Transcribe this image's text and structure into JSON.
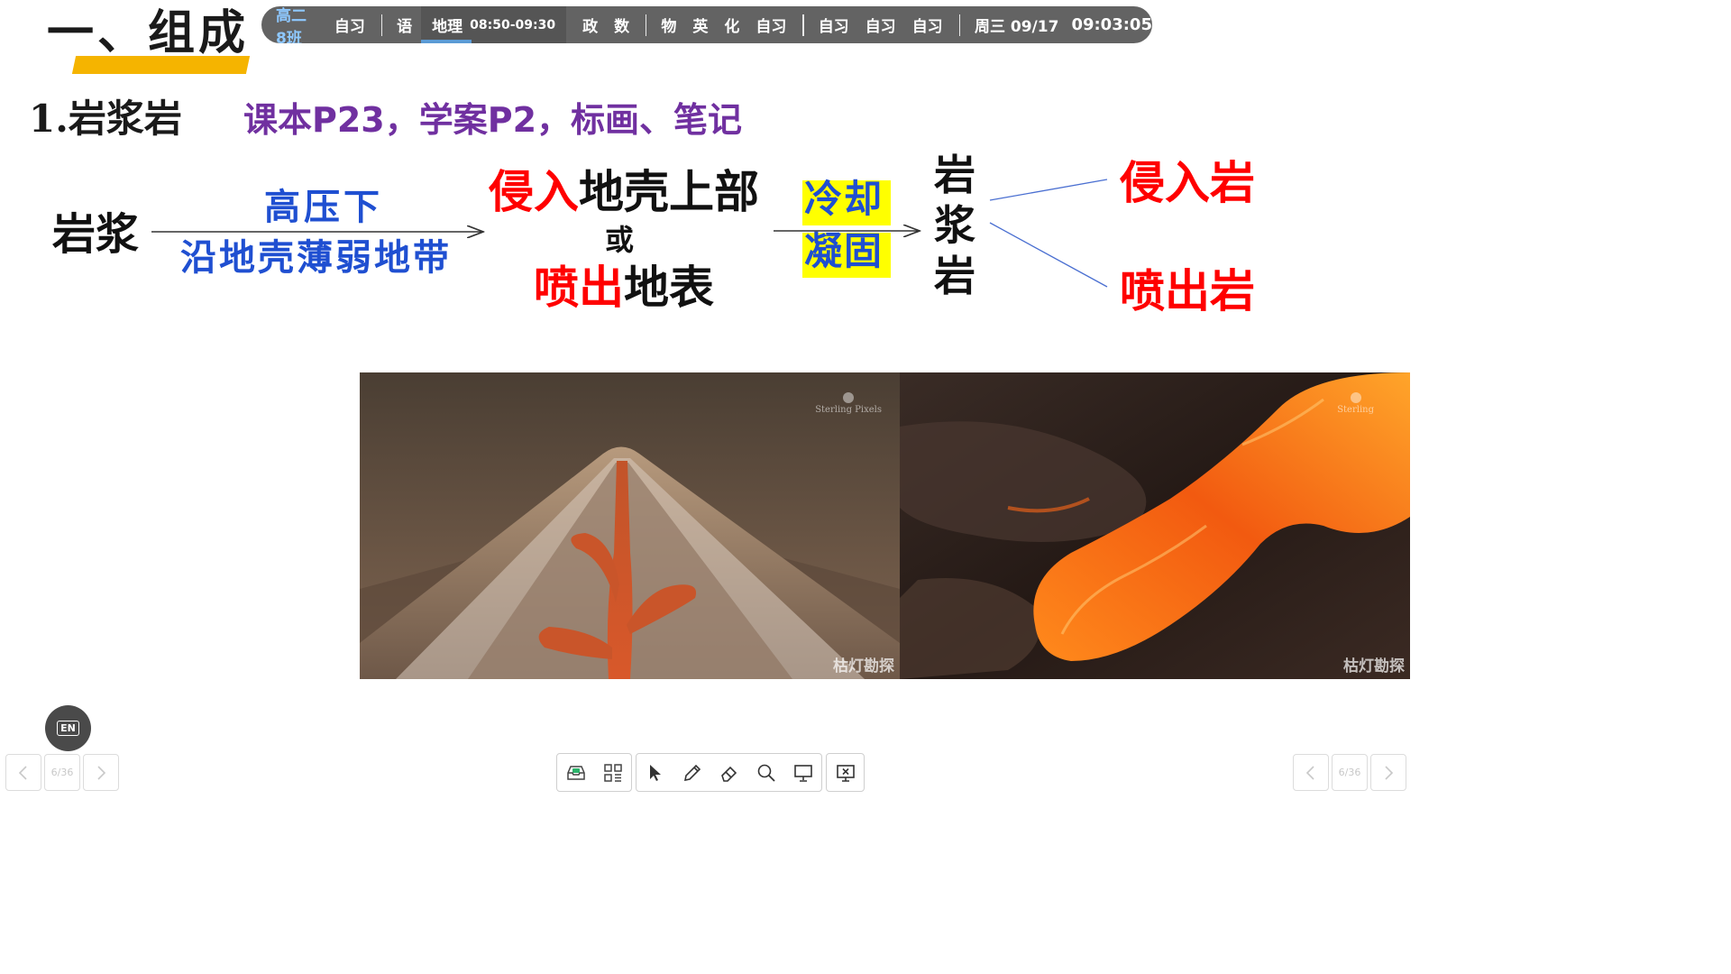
{
  "header": {
    "section_title": "一、组成"
  },
  "schedule": {
    "class_name": "高二8班",
    "slots_before": [
      "自习"
    ],
    "slot_chinese": "语",
    "current": {
      "subject": "地理",
      "time": "08:50-09:30",
      "progress": 0.35
    },
    "slots_mid": [
      "政",
      "数"
    ],
    "slots_group2": [
      "物",
      "英",
      "化",
      "自习"
    ],
    "slots_group3": [
      "自习",
      "自习",
      "自习"
    ],
    "date": "周三 09/17",
    "clock": "09:03:05"
  },
  "content": {
    "subheading": "1.岩浆岩",
    "reference": "课本P23，学案P2，标画、笔记"
  },
  "diagram": {
    "source": "岩浆",
    "condition_top": "高压下",
    "condition_bottom": "沿地壳薄弱地带",
    "path_top_highlight": "侵入",
    "path_top_rest": "地壳上部",
    "path_or": "或",
    "path_bottom_highlight": "喷出",
    "path_bottom_rest": "地表",
    "process_top": "冷却",
    "process_bottom": "凝固",
    "result": "岩浆岩",
    "branch_top": "侵入岩",
    "branch_bottom": "喷出岩",
    "colors": {
      "condition": "#1f4fd1",
      "highlight": "#ff0000",
      "marker": "#ffff00",
      "reference": "#7030a0",
      "title_bar": "#f5b400"
    }
  },
  "media": {
    "left_watermark": "枯灯勘探",
    "left_studio": "Sterling Pixels",
    "right_watermark": "枯灯勘探",
    "right_studio": "Sterling"
  },
  "controls": {
    "lang_badge": "EN",
    "page_left": "6/36",
    "page_right": "6/36"
  }
}
